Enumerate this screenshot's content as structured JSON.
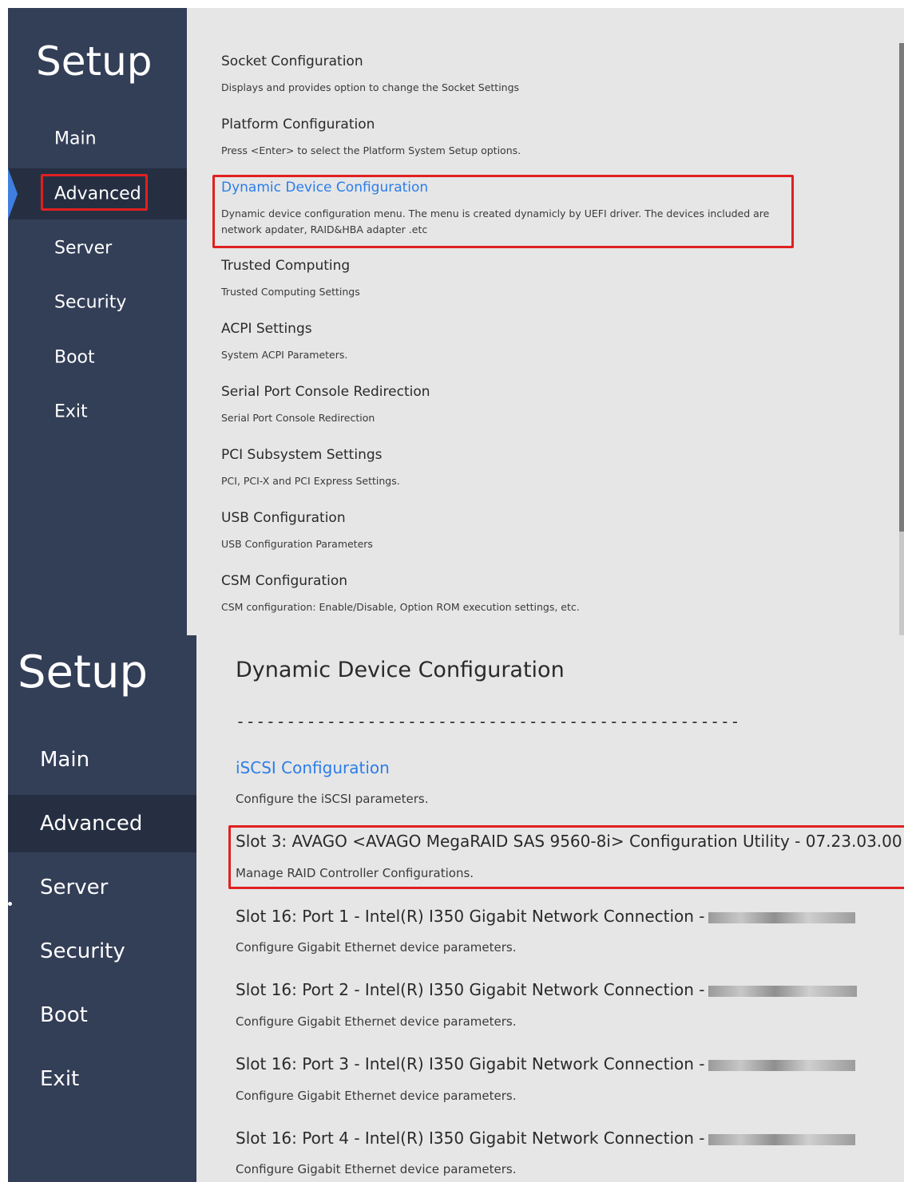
{
  "top_panel": {
    "title": "Setup",
    "nav": [
      "Main",
      "Advanced",
      "Server",
      "Security",
      "Boot",
      "Exit"
    ],
    "active_nav": "Advanced",
    "items": [
      {
        "title": "Socket Configuration",
        "desc": "Displays and provides option to change the Socket Settings"
      },
      {
        "title": "Platform Configuration",
        "desc": "Press <Enter> to select the Platform System Setup options."
      },
      {
        "title": "Dynamic Device Configuration",
        "desc": "Dynamic device configuration menu. The menu is created dynamicly by UEFI driver. The devices included are",
        "desc2": "network apdater, RAID&HBA adapter .etc"
      },
      {
        "title": "Trusted Computing",
        "desc": "Trusted Computing Settings"
      },
      {
        "title": "ACPI Settings",
        "desc": "System ACPI Parameters."
      },
      {
        "title": "Serial Port Console Redirection",
        "desc": "Serial Port Console Redirection"
      },
      {
        "title": "PCI Subsystem Settings",
        "desc": "PCI, PCI-X and PCI Express Settings."
      },
      {
        "title": "USB Configuration",
        "desc": "USB Configuration Parameters"
      },
      {
        "title": "CSM Configuration",
        "desc": "CSM configuration: Enable/Disable, Option ROM execution settings, etc."
      }
    ]
  },
  "bottom_panel": {
    "title": "Setup",
    "nav": [
      "Main",
      "Advanced",
      "Server",
      "Security",
      "Boot",
      "Exit"
    ],
    "active_nav": "Advanced",
    "heading": "Dynamic Device Configuration",
    "separator": "--------------------------------------------------",
    "items": [
      {
        "title": "iSCSI Configuration",
        "desc": "Configure the iSCSI parameters."
      },
      {
        "title": "Slot 3: AVAGO <AVAGO MegaRAID SAS 9560-8i> Configuration Utility - 07.23.03.00",
        "desc": "Manage RAID Controller Configurations."
      },
      {
        "title": "Slot 16: Port 1 - Intel(R) I350 Gigabit Network Connection -",
        "desc": "Configure Gigabit Ethernet device parameters."
      },
      {
        "title": "Slot 16: Port 2 - Intel(R) I350 Gigabit Network Connection -",
        "desc": "Configure Gigabit Ethernet device parameters."
      },
      {
        "title": "Slot 16: Port 3 - Intel(R) I350 Gigabit Network Connection -",
        "desc": "Configure Gigabit Ethernet device parameters."
      },
      {
        "title": "Slot 16: Port 4 - Intel(R) I350 Gigabit Network Connection -",
        "desc": "Configure Gigabit Ethernet device parameters."
      }
    ]
  },
  "colors": {
    "sidebar": "#333e57",
    "sidebar_active": "#262f42",
    "content_bg": "#e6e6e6",
    "link": "#2b7de9",
    "highlight": "#e02020",
    "active_marker": "#3f7fe0"
  }
}
